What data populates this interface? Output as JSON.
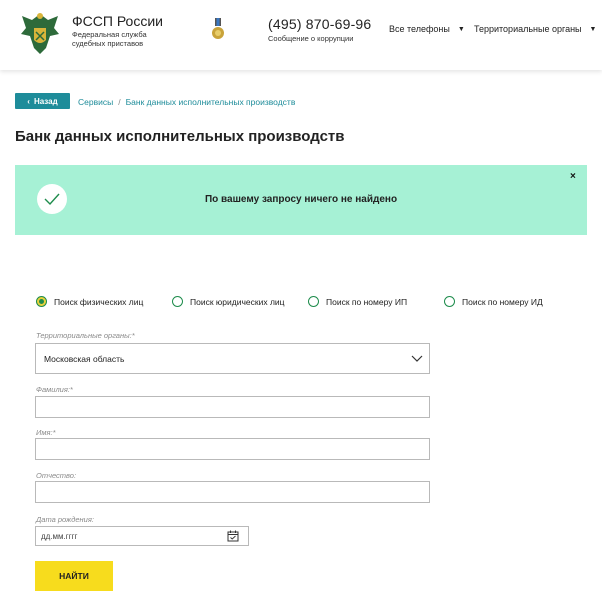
{
  "header": {
    "brand_title": "ФССП России",
    "brand_subtitle": "Федеральная служба судебных приставов",
    "phone": "(495) 870-69-96",
    "phone_sub": "Сообщение о коррупции",
    "nav": [
      {
        "label": "Все телефоны",
        "icon": "caret-down-icon"
      },
      {
        "label": "Территориальные органы",
        "icon": "caret-down-icon"
      }
    ]
  },
  "breadcrumb": {
    "back_label": "Назад",
    "items": [
      "Сервисы",
      "Банк данных исполнительных производств"
    ],
    "separator": "/"
  },
  "page_title": "Банк данных исполнительных производств",
  "alert": {
    "text": "По вашему запросу ничего не найдено",
    "close": "×",
    "icon": "check-icon"
  },
  "search_modes": [
    {
      "label": "Поиск физических лиц",
      "selected": true
    },
    {
      "label": "Поиск юридических лиц",
      "selected": false
    },
    {
      "label": "Поиск по номеру ИП",
      "selected": false
    },
    {
      "label": "Поиск по номеру ИД",
      "selected": false
    }
  ],
  "form": {
    "region_label": "Территориальные органы:*",
    "region_value": "Московская область",
    "lastname_label": "Фамилия:*",
    "lastname_value": "",
    "firstname_label": "Имя:*",
    "firstname_value": "",
    "patronymic_label": "Отчество:",
    "patronymic_value": "",
    "birthdate_label": "Дата рождения:",
    "birthdate_placeholder": "дд.мм.гггг",
    "submit_label": "НАЙТИ"
  },
  "colors": {
    "accent": "#1e8c9a",
    "alert_bg": "#a6f1d5",
    "button_bg": "#f7dc1d",
    "radio_green": "#1e8c4c"
  }
}
